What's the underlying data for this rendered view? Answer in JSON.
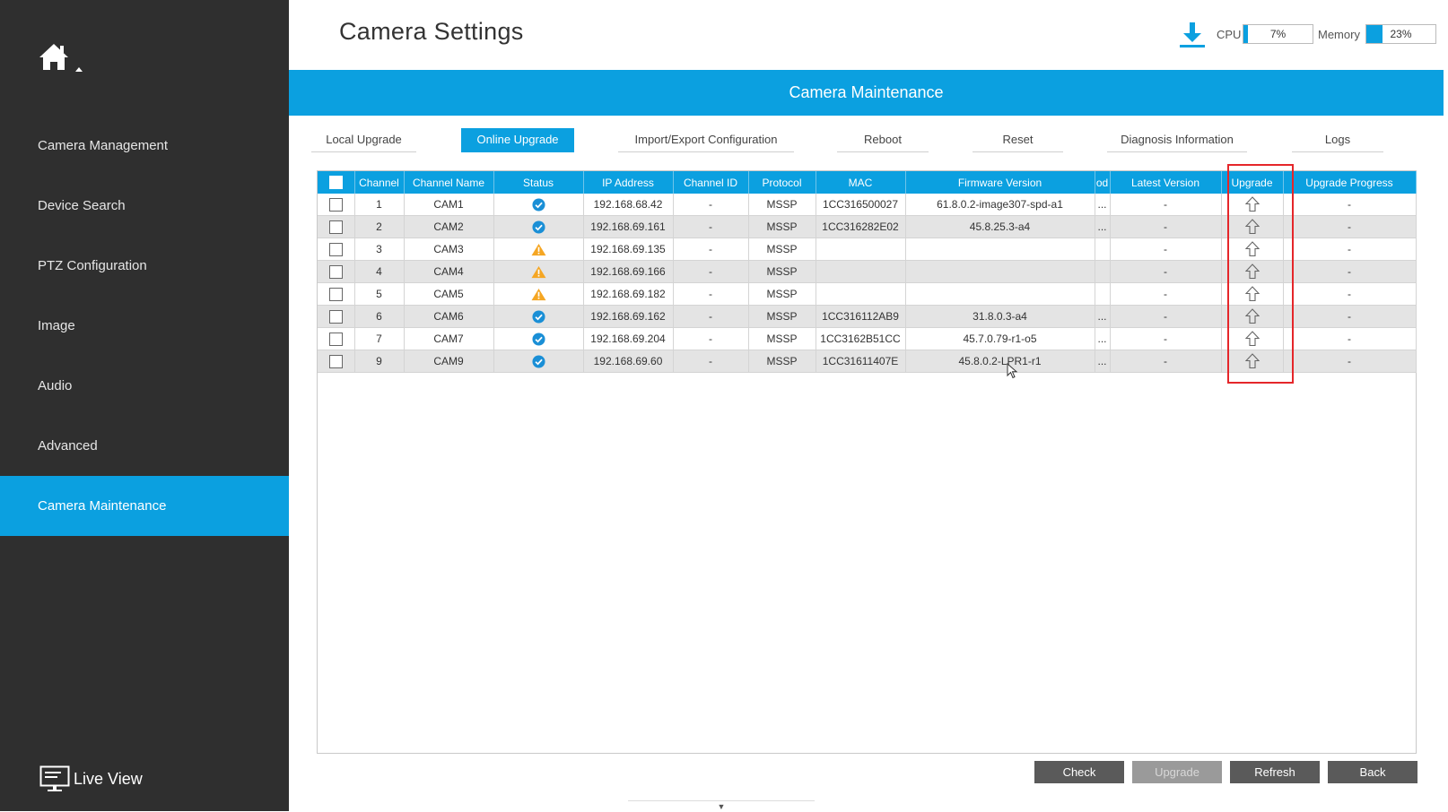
{
  "sidebar": {
    "items": [
      {
        "label": "Camera Management"
      },
      {
        "label": "Device Search"
      },
      {
        "label": "PTZ Configuration"
      },
      {
        "label": "Image"
      },
      {
        "label": "Audio"
      },
      {
        "label": "Advanced"
      },
      {
        "label": "Camera Maintenance",
        "active": true
      }
    ],
    "live_view_label": "Live View"
  },
  "header": {
    "title": "Camera Settings",
    "cpu": {
      "label": "CPU",
      "value": "7%",
      "fraction": 0.07
    },
    "memory": {
      "label": "Memory",
      "value": "23%",
      "fraction": 0.23
    }
  },
  "banner": {
    "title": "Camera Maintenance"
  },
  "tabs": [
    {
      "label": "Local Upgrade"
    },
    {
      "label": "Online Upgrade",
      "active": true
    },
    {
      "label": "Import/Export Configuration"
    },
    {
      "label": "Reboot"
    },
    {
      "label": "Reset"
    },
    {
      "label": "Diagnosis Information"
    },
    {
      "label": "Logs"
    }
  ],
  "table": {
    "columns": [
      "Channel",
      "Channel Name",
      "Status",
      "IP Address",
      "Channel ID",
      "Protocol",
      "MAC",
      "Firmware Version",
      "od",
      "Latest Version",
      "Upgrade",
      "Upgrade Progress"
    ],
    "rows": [
      {
        "channel": "1",
        "name": "CAM1",
        "status": "ok",
        "ip": "192.168.68.42",
        "channel_id": "-",
        "protocol": "MSSP",
        "mac": "1CC316500027",
        "firmware": "61.8.0.2-image307-spd-a1",
        "od": "...",
        "latest": "-",
        "progress": "-"
      },
      {
        "channel": "2",
        "name": "CAM2",
        "status": "ok",
        "ip": "192.168.69.161",
        "channel_id": "-",
        "protocol": "MSSP",
        "mac": "1CC316282E02",
        "firmware": "45.8.25.3-a4",
        "od": "...",
        "latest": "-",
        "progress": "-"
      },
      {
        "channel": "3",
        "name": "CAM3",
        "status": "warning",
        "ip": "192.168.69.135",
        "channel_id": "-",
        "protocol": "MSSP",
        "mac": "",
        "firmware": "",
        "od": "",
        "latest": "-",
        "progress": "-"
      },
      {
        "channel": "4",
        "name": "CAM4",
        "status": "warning",
        "ip": "192.168.69.166",
        "channel_id": "-",
        "protocol": "MSSP",
        "mac": "",
        "firmware": "",
        "od": "",
        "latest": "-",
        "progress": "-"
      },
      {
        "channel": "5",
        "name": "CAM5",
        "status": "warning",
        "ip": "192.168.69.182",
        "channel_id": "-",
        "protocol": "MSSP",
        "mac": "",
        "firmware": "",
        "od": "",
        "latest": "-",
        "progress": "-"
      },
      {
        "channel": "6",
        "name": "CAM6",
        "status": "ok",
        "ip": "192.168.69.162",
        "channel_id": "-",
        "protocol": "MSSP",
        "mac": "1CC316112AB9",
        "firmware": "31.8.0.3-a4",
        "od": "...",
        "latest": "-",
        "progress": "-"
      },
      {
        "channel": "7",
        "name": "CAM7",
        "status": "ok",
        "ip": "192.168.69.204",
        "channel_id": "-",
        "protocol": "MSSP",
        "mac": "1CC3162B51CC",
        "firmware": "45.7.0.79-r1-o5",
        "od": "...",
        "latest": "-",
        "progress": "-"
      },
      {
        "channel": "9",
        "name": "CAM9",
        "status": "ok",
        "ip": "192.168.69.60",
        "channel_id": "-",
        "protocol": "MSSP",
        "mac": "1CC31611407E",
        "firmware": "45.8.0.2-LPR1-r1",
        "od": "...",
        "latest": "-",
        "progress": "-"
      }
    ]
  },
  "buttons": {
    "check": "Check",
    "upgrade": "Upgrade",
    "refresh": "Refresh",
    "back": "Back"
  },
  "colors": {
    "accent": "#0ba0e0",
    "sidebar_bg": "#2f2f2f",
    "ok": "#1a8fd6",
    "warning": "#f5a623",
    "highlight": "#e5262a"
  },
  "icons": {
    "home": "home-icon",
    "download": "download-icon",
    "status_ok": "check-circle-icon",
    "status_warning": "warning-triangle-icon",
    "upgrade": "upload-arrow-icon",
    "live_view": "monitor-icon"
  }
}
